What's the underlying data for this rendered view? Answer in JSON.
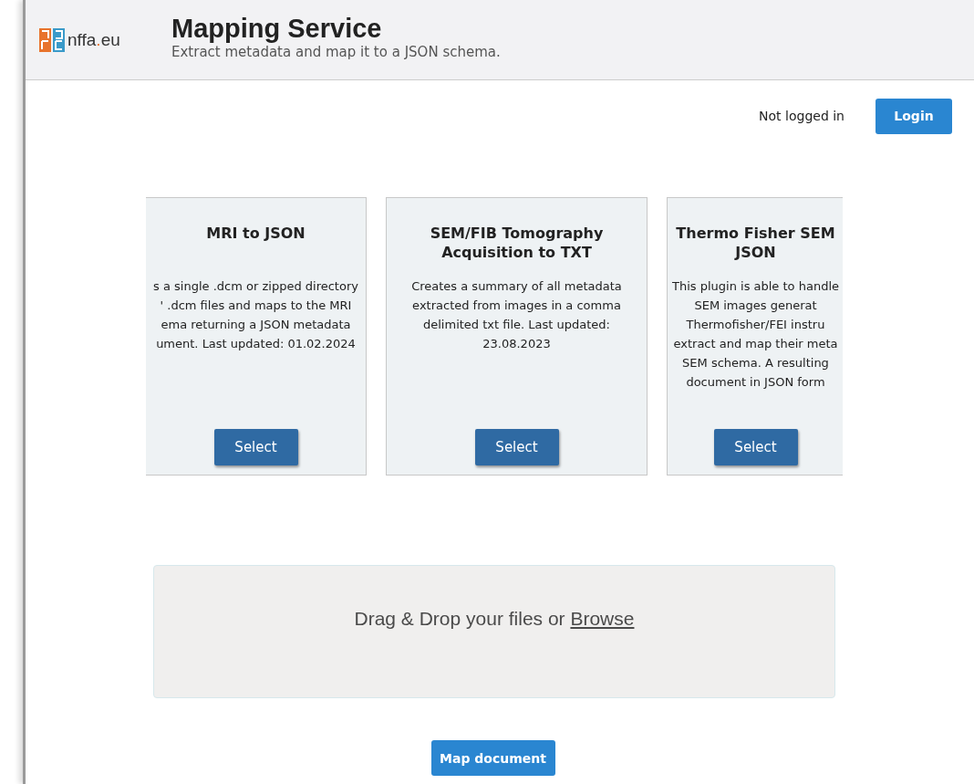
{
  "header": {
    "logo_text": "nffa",
    "logo_dot": ".",
    "logo_suffix": "eu",
    "title": "Mapping Service",
    "subtitle": "Extract metadata and map it to a JSON schema."
  },
  "auth": {
    "status": "Not logged in",
    "button": "Login"
  },
  "plugins": [
    {
      "kind": "left",
      "title": "MRI to JSON",
      "description": [
        "s a single .dcm or zipped directory",
        "' .dcm files and maps to the MRI",
        "ema returning a JSON metadata",
        "ument. Last updated: 01.02.2024"
      ],
      "button": "Select"
    },
    {
      "kind": "whole",
      "title": "SEM/FIB Tomography Acquisition to TXT",
      "description": [
        "Creates a summary of all metadata",
        "extracted from images in a comma",
        "delimited txt file. Last updated:",
        "23.08.2023"
      ],
      "button": "Select"
    },
    {
      "kind": "right",
      "title": "Thermo Fisher SEM JSON",
      "description": [
        "This plugin is able to handle",
        "SEM images generat",
        "Thermofisher/FEI instru",
        "extract and map their meta",
        "SEM schema. A resulting",
        "document in JSON form"
      ],
      "button": "Select"
    }
  ],
  "dropzone": {
    "text": "Drag & Drop your files or",
    "link": "Browse"
  },
  "submit": {
    "label": "Map document"
  }
}
